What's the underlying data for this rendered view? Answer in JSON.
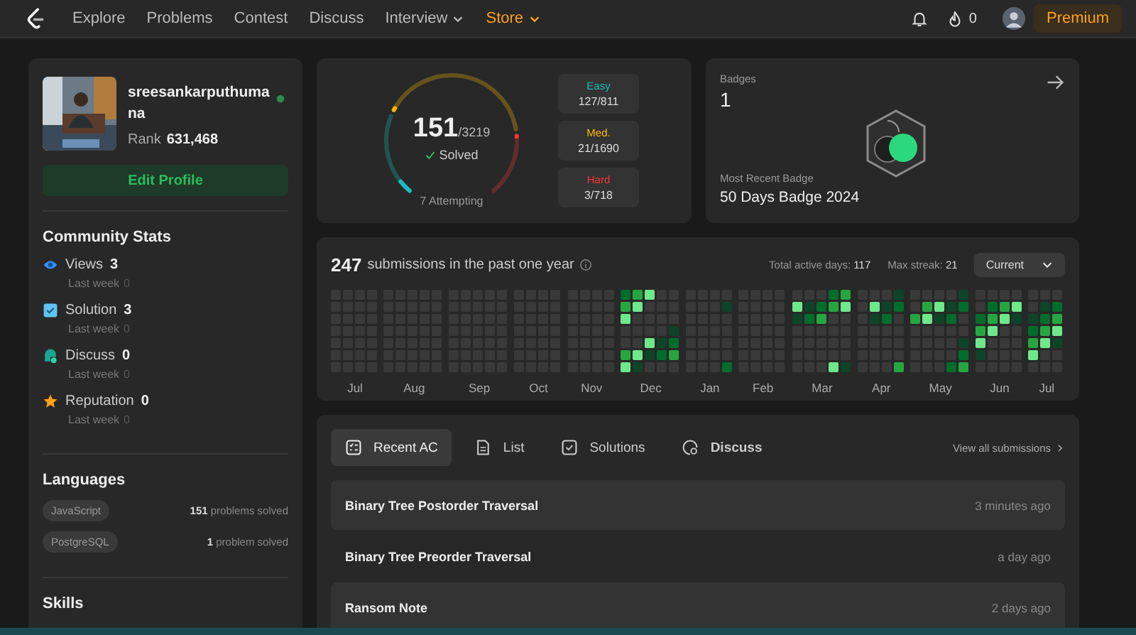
{
  "nav": {
    "items": [
      {
        "label": "Explore",
        "highlighted": false,
        "dropdown": false
      },
      {
        "label": "Problems",
        "highlighted": false,
        "dropdown": false
      },
      {
        "label": "Contest",
        "highlighted": false,
        "dropdown": false
      },
      {
        "label": "Discuss",
        "highlighted": false,
        "dropdown": false
      },
      {
        "label": "Interview",
        "highlighted": false,
        "dropdown": true
      },
      {
        "label": "Store",
        "highlighted": true,
        "dropdown": true
      }
    ],
    "streak_count": "0",
    "premium": "Premium"
  },
  "profile": {
    "username": "sreesankarputhumana",
    "rank_label": "Rank",
    "rank": "631,468",
    "edit_button": "Edit Profile"
  },
  "community_stats": {
    "title": "Community Stats",
    "items": [
      {
        "kind": "views",
        "label": "Views",
        "value": "3",
        "sub_label": "Last week",
        "sub_value": "0"
      },
      {
        "kind": "solution",
        "label": "Solution",
        "value": "3",
        "sub_label": "Last week",
        "sub_value": "0"
      },
      {
        "kind": "discuss",
        "label": "Discuss",
        "value": "0",
        "sub_label": "Last week",
        "sub_value": "0"
      },
      {
        "kind": "reputation",
        "label": "Reputation",
        "value": "0",
        "sub_label": "Last week",
        "sub_value": "0"
      }
    ]
  },
  "languages": {
    "title": "Languages",
    "items": [
      {
        "name": "JavaScript",
        "count": "151",
        "unit": "problems solved"
      },
      {
        "name": "PostgreSQL",
        "count": "1",
        "unit": "problem solved"
      }
    ]
  },
  "skills": {
    "title": "Skills"
  },
  "solved": {
    "total": "151",
    "of": "/3219",
    "label": "Solved",
    "attempting": "7 Attempting",
    "difficulties": [
      {
        "label": "Easy",
        "value": "127/811",
        "color": "#1cbaba"
      },
      {
        "label": "Med.",
        "value": "21/1690",
        "color": "#ffb700"
      },
      {
        "label": "Hard",
        "value": "3/718",
        "color": "#f63737"
      }
    ]
  },
  "badges": {
    "title": "Badges",
    "count": "1",
    "recent_label": "Most Recent Badge",
    "recent_name": "50 Days Badge 2024"
  },
  "heatmap": {
    "count": "247",
    "text": "submissions in the past one year",
    "active_label": "Total active days:",
    "active": "117",
    "streak_label": "Max streak:",
    "streak": "21",
    "select": "Current",
    "months": [
      "Jul",
      "Aug",
      "Sep",
      "Oct",
      "Nov",
      "Dec",
      "Jan",
      "Feb",
      "Mar",
      "Apr",
      "May",
      "Jun",
      "Jul"
    ]
  },
  "activity": {
    "tabs": [
      {
        "kind": "recent",
        "label": "Recent AC",
        "selected": true
      },
      {
        "kind": "list",
        "label": "List",
        "selected": false
      },
      {
        "kind": "solutions",
        "label": "Solutions",
        "selected": false
      },
      {
        "kind": "discuss",
        "label": "Discuss",
        "selected": false
      }
    ],
    "view_all": "View all submissions",
    "rows": [
      {
        "title": "Binary Tree Postorder Traversal",
        "time": "3 minutes ago"
      },
      {
        "title": "Binary Tree Preorder Traversal",
        "time": "a day ago"
      },
      {
        "title": "Ransom Note",
        "time": "2 days ago"
      }
    ]
  }
}
